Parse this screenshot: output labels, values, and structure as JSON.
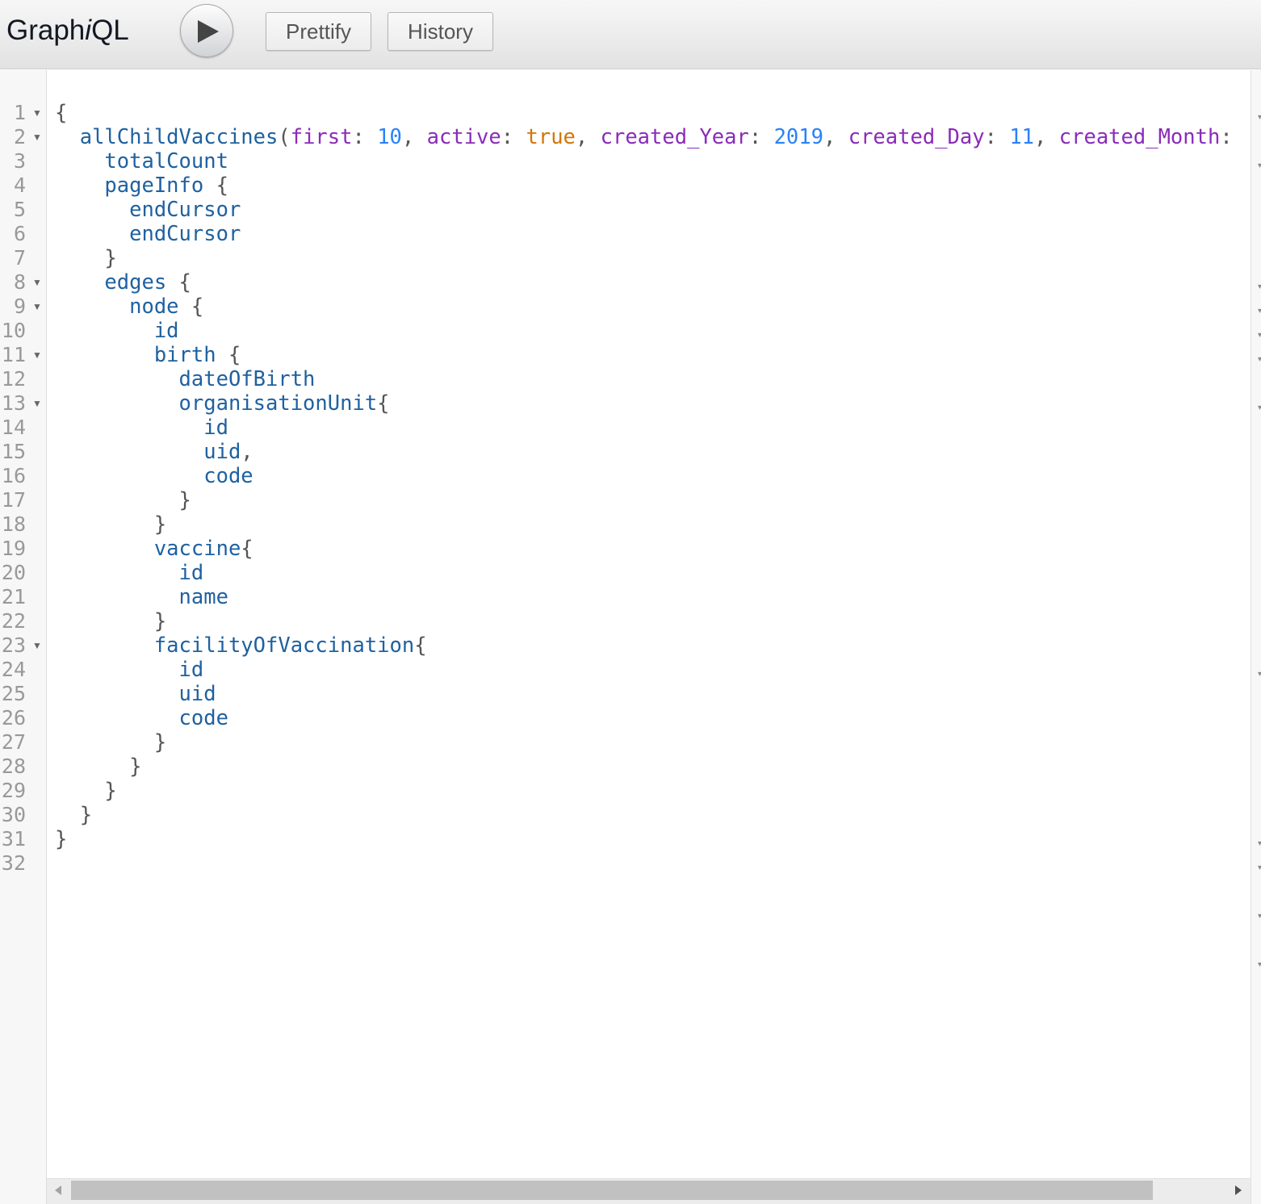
{
  "toolbar": {
    "title_prefix": "Graph",
    "title_italic": "i",
    "title_suffix": "QL",
    "prettify_label": "Prettify",
    "history_label": "History"
  },
  "icons": {
    "execute": "play-icon",
    "fold": "fold-arrow-icon"
  },
  "colors": {
    "field": "#1f61a0",
    "argument": "#8b2bb9",
    "number": "#2882f9",
    "keyword": "#d47509",
    "punctuation": "#555555"
  },
  "editor": {
    "lines": [
      {
        "n": "1",
        "fold": true,
        "tokens": [
          [
            "pn",
            "{"
          ]
        ]
      },
      {
        "n": "2",
        "fold": true,
        "tokens": [
          [
            "pn",
            "  "
          ],
          [
            "fd",
            "allChildVaccines"
          ],
          [
            "pn",
            "("
          ],
          [
            "ar",
            "first"
          ],
          [
            "pn",
            ": "
          ],
          [
            "nm",
            "10"
          ],
          [
            "pn",
            ", "
          ],
          [
            "ar",
            "active"
          ],
          [
            "pn",
            ": "
          ],
          [
            "kw",
            "true"
          ],
          [
            "pn",
            ", "
          ],
          [
            "ar",
            "created_Year"
          ],
          [
            "pn",
            ": "
          ],
          [
            "nm",
            "2019"
          ],
          [
            "pn",
            ", "
          ],
          [
            "ar",
            "created_Day"
          ],
          [
            "pn",
            ": "
          ],
          [
            "nm",
            "11"
          ],
          [
            "pn",
            ", "
          ],
          [
            "ar",
            "created_Month"
          ],
          [
            "pn",
            ":"
          ]
        ]
      },
      {
        "n": "3",
        "fold": false,
        "tokens": [
          [
            "pn",
            "    "
          ],
          [
            "fd",
            "totalCount"
          ]
        ]
      },
      {
        "n": "4",
        "fold": false,
        "tokens": [
          [
            "pn",
            "    "
          ],
          [
            "fd",
            "pageInfo"
          ],
          [
            "pn",
            " {"
          ]
        ]
      },
      {
        "n": "5",
        "fold": false,
        "tokens": [
          [
            "pn",
            "      "
          ],
          [
            "fd",
            "endCursor"
          ]
        ]
      },
      {
        "n": "6",
        "fold": false,
        "tokens": [
          [
            "pn",
            "      "
          ],
          [
            "fd",
            "endCursor"
          ]
        ]
      },
      {
        "n": "7",
        "fold": false,
        "tokens": [
          [
            "pn",
            "    }"
          ]
        ]
      },
      {
        "n": "8",
        "fold": true,
        "tokens": [
          [
            "pn",
            "    "
          ],
          [
            "fd",
            "edges"
          ],
          [
            "pn",
            " {"
          ]
        ]
      },
      {
        "n": "9",
        "fold": true,
        "tokens": [
          [
            "pn",
            "      "
          ],
          [
            "fd",
            "node"
          ],
          [
            "pn",
            " {"
          ]
        ]
      },
      {
        "n": "10",
        "fold": false,
        "tokens": [
          [
            "pn",
            "        "
          ],
          [
            "fd",
            "id"
          ]
        ]
      },
      {
        "n": "11",
        "fold": true,
        "tokens": [
          [
            "pn",
            "        "
          ],
          [
            "fd",
            "birth"
          ],
          [
            "pn",
            " {"
          ]
        ]
      },
      {
        "n": "12",
        "fold": false,
        "tokens": [
          [
            "pn",
            "          "
          ],
          [
            "fd",
            "dateOfBirth"
          ]
        ]
      },
      {
        "n": "13",
        "fold": true,
        "tokens": [
          [
            "pn",
            "          "
          ],
          [
            "fd",
            "organisationUnit"
          ],
          [
            "pn",
            "{"
          ]
        ]
      },
      {
        "n": "14",
        "fold": false,
        "tokens": [
          [
            "pn",
            "            "
          ],
          [
            "fd",
            "id"
          ]
        ]
      },
      {
        "n": "15",
        "fold": false,
        "tokens": [
          [
            "pn",
            "            "
          ],
          [
            "fd",
            "uid"
          ],
          [
            "pn",
            ","
          ]
        ]
      },
      {
        "n": "16",
        "fold": false,
        "tokens": [
          [
            "pn",
            "            "
          ],
          [
            "fd",
            "code"
          ]
        ]
      },
      {
        "n": "17",
        "fold": false,
        "tokens": [
          [
            "pn",
            "          }"
          ]
        ]
      },
      {
        "n": "18",
        "fold": false,
        "tokens": [
          [
            "pn",
            "        }"
          ]
        ]
      },
      {
        "n": "19",
        "fold": false,
        "tokens": [
          [
            "pn",
            "        "
          ],
          [
            "fd",
            "vaccine"
          ],
          [
            "pn",
            "{"
          ]
        ]
      },
      {
        "n": "20",
        "fold": false,
        "tokens": [
          [
            "pn",
            "          "
          ],
          [
            "fd",
            "id"
          ]
        ]
      },
      {
        "n": "21",
        "fold": false,
        "tokens": [
          [
            "pn",
            "          "
          ],
          [
            "fd",
            "name"
          ]
        ]
      },
      {
        "n": "22",
        "fold": false,
        "tokens": [
          [
            "pn",
            "        }"
          ]
        ]
      },
      {
        "n": "23",
        "fold": true,
        "tokens": [
          [
            "pn",
            "        "
          ],
          [
            "fd",
            "facilityOfVaccination"
          ],
          [
            "pn",
            "{"
          ]
        ]
      },
      {
        "n": "24",
        "fold": false,
        "tokens": [
          [
            "pn",
            "          "
          ],
          [
            "fd",
            "id"
          ]
        ]
      },
      {
        "n": "25",
        "fold": false,
        "tokens": [
          [
            "pn",
            "          "
          ],
          [
            "fd",
            "uid"
          ]
        ]
      },
      {
        "n": "26",
        "fold": false,
        "tokens": [
          [
            "pn",
            "          "
          ],
          [
            "fd",
            "code"
          ]
        ]
      },
      {
        "n": "27",
        "fold": false,
        "tokens": [
          [
            "pn",
            "        }"
          ]
        ]
      },
      {
        "n": "28",
        "fold": false,
        "tokens": [
          [
            "pn",
            "      }"
          ]
        ]
      },
      {
        "n": "29",
        "fold": false,
        "tokens": [
          [
            "pn",
            "    }"
          ]
        ]
      },
      {
        "n": "30",
        "fold": false,
        "tokens": [
          [
            "pn",
            "  }"
          ]
        ]
      },
      {
        "n": "31",
        "fold": false,
        "tokens": [
          [
            "pn",
            "}"
          ]
        ]
      },
      {
        "n": "32",
        "fold": false,
        "tokens": []
      }
    ]
  }
}
